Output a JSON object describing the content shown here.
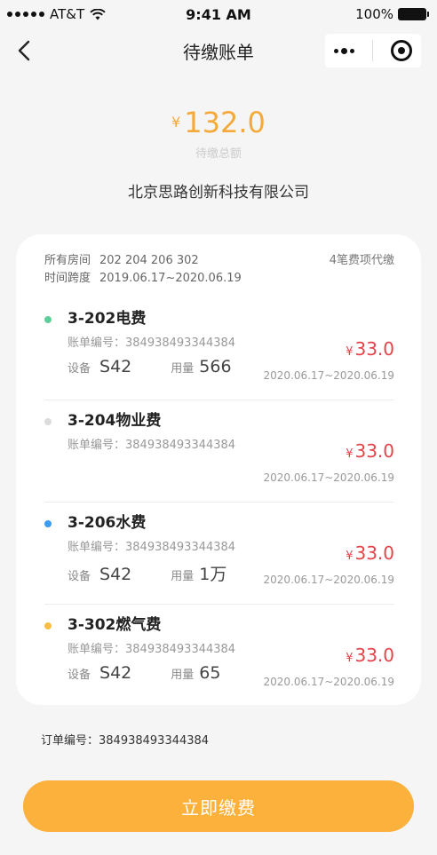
{
  "status_bar": {
    "carrier": "AT&T",
    "time": "9:41 AM",
    "battery": "100%"
  },
  "nav": {
    "title": "待缴账单"
  },
  "summary": {
    "currency": "¥",
    "total": "132.0",
    "label": "待缴总额",
    "company": "北京思路创新科技有限公司"
  },
  "card": {
    "rooms_label": "所有房间",
    "rooms_value": "202 204 206 302",
    "period_label": "时间跨度",
    "period_value": "2019.06.17~2020.06.19",
    "agent_note": "4笔费项代缴"
  },
  "bills": [
    {
      "title": "3-202电费",
      "no_label": "账单编号：",
      "no": "384938493344384",
      "device_label": "设备",
      "device": "S42",
      "usage_label": "用量",
      "usage": "566",
      "currency": "¥",
      "amount": "33.0",
      "period": "2020.06.17~2020.06.19",
      "dot_color": "#5fcf99"
    },
    {
      "title": "3-204物业费",
      "no_label": "账单编号：",
      "no": "384938493344384",
      "currency": "¥",
      "amount": "33.0",
      "period": "2020.06.17~2020.06.19",
      "dot_color": "#dcdcdc"
    },
    {
      "title": "3-206水费",
      "no_label": "账单编号：",
      "no": "384938493344384",
      "device_label": "设备",
      "device": "S42",
      "usage_label": "用量",
      "usage": "1万",
      "currency": "¥",
      "amount": "33.0",
      "period": "2020.06.17~2020.06.19",
      "dot_color": "#3b9cf0"
    },
    {
      "title": "3-302燃气费",
      "no_label": "账单编号：",
      "no": "384938493344384",
      "device_label": "设备",
      "device": "S42",
      "usage_label": "用量",
      "usage": "65",
      "currency": "¥",
      "amount": "33.0",
      "period": "2020.06.17~2020.06.19",
      "dot_color": "#fbbe44"
    }
  ],
  "order": {
    "label": "订单编号：",
    "value": "384938493344384"
  },
  "pay_button": {
    "label": "立即缴费"
  },
  "colors": {
    "accent": "#fdb13d",
    "amount_red": "#e5434a",
    "total_orange": "#f6a93b"
  }
}
